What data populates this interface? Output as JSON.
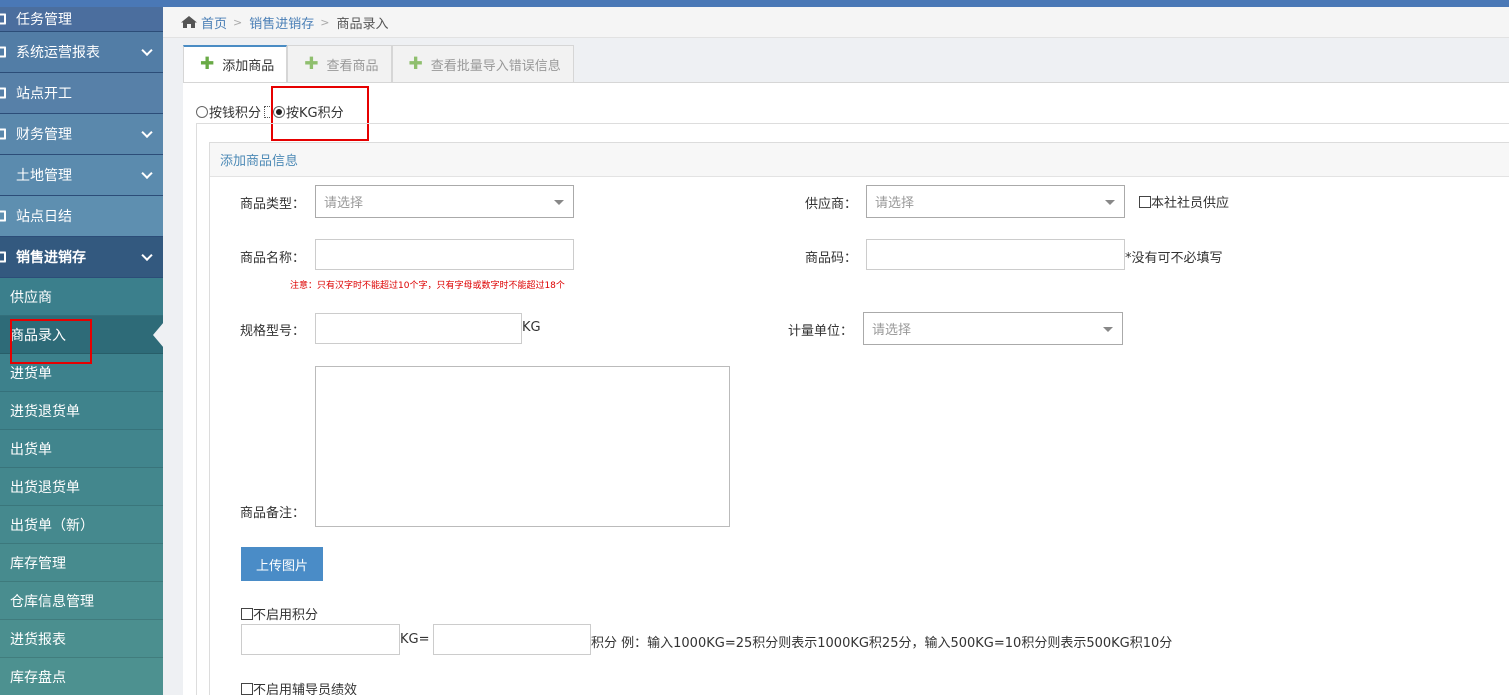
{
  "breadcrumb": {
    "home": "首页",
    "parent": "销售进销存",
    "current": "商品录入"
  },
  "sidebar": {
    "menus": [
      {
        "label": "任务管理"
      },
      {
        "label": "系统运营报表"
      },
      {
        "label": "站点开工"
      },
      {
        "label": "财务管理"
      },
      {
        "label": "土地管理"
      },
      {
        "label": "站点日结"
      },
      {
        "label": "销售进销存"
      }
    ],
    "subitems": [
      {
        "label": "供应商"
      },
      {
        "label": "商品录入"
      },
      {
        "label": "进货单"
      },
      {
        "label": "进货退货单"
      },
      {
        "label": "出货单"
      },
      {
        "label": "出货退货单"
      },
      {
        "label": "出货单（新）"
      },
      {
        "label": "库存管理"
      },
      {
        "label": "仓库信息管理"
      },
      {
        "label": "进货报表"
      },
      {
        "label": "库存盘点"
      }
    ]
  },
  "tabs": [
    {
      "label": "添加商品"
    },
    {
      "label": "查看商品"
    },
    {
      "label": "查看批量导入错误信息"
    }
  ],
  "scoring": {
    "by_money": "按钱积分",
    "by_kg": "按KG积分"
  },
  "form": {
    "section_title": "添加商品信息",
    "type_label": "商品类型：",
    "type_placeholder": "请选择",
    "supplier_label": "供应商：",
    "supplier_placeholder": "请选择",
    "member_supply": "本社社员供应",
    "name_label": "商品名称：",
    "name_note": "注意：只有汉字时不能超过10个字，只有字母或数字时不能超过18个",
    "code_label": "商品码：",
    "code_hint": "*没有可不必填写",
    "spec_label": "规格型号：",
    "spec_unit": "KG",
    "measure_label": "计量单位：",
    "measure_placeholder": "请选择",
    "remark_label": "商品备注：",
    "upload_label": "上传图片",
    "disable_points": "不启用积分",
    "kg_eq": "KG=",
    "points_example": "积分 例：输入1000KG=25积分则表示1000KG积25分，输入500KG=10积分则表示500KG积10分",
    "disable_tutor": "不启用辅导员绩效"
  }
}
